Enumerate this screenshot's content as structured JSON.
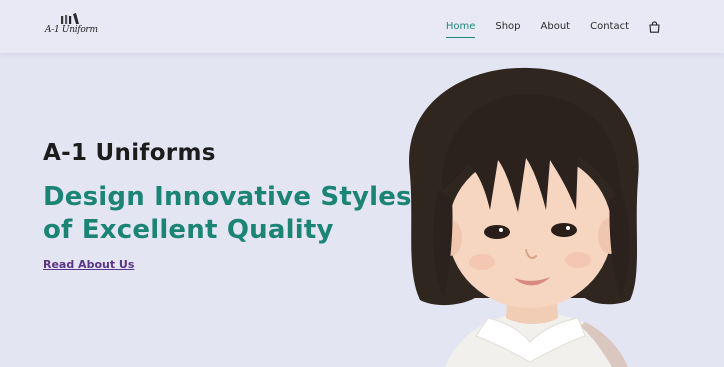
{
  "header": {
    "logo_text": "A-1 Uniform",
    "nav": [
      "Home",
      "Shop",
      "About",
      "Contact"
    ],
    "active": "Home",
    "cart_icon": "shopping-bag-icon"
  },
  "hero": {
    "title": "A-1 Uniforms",
    "subtitle_line1": "Design Innovative Styles",
    "subtitle_line2": "of Excellent Quality",
    "link": "Read About Us",
    "image": "girl-in-uniform-photo"
  },
  "colors": {
    "background": "#e4e5f3",
    "accent": "#1c8475",
    "link": "#5a3486",
    "text": "#1c1c1c"
  }
}
